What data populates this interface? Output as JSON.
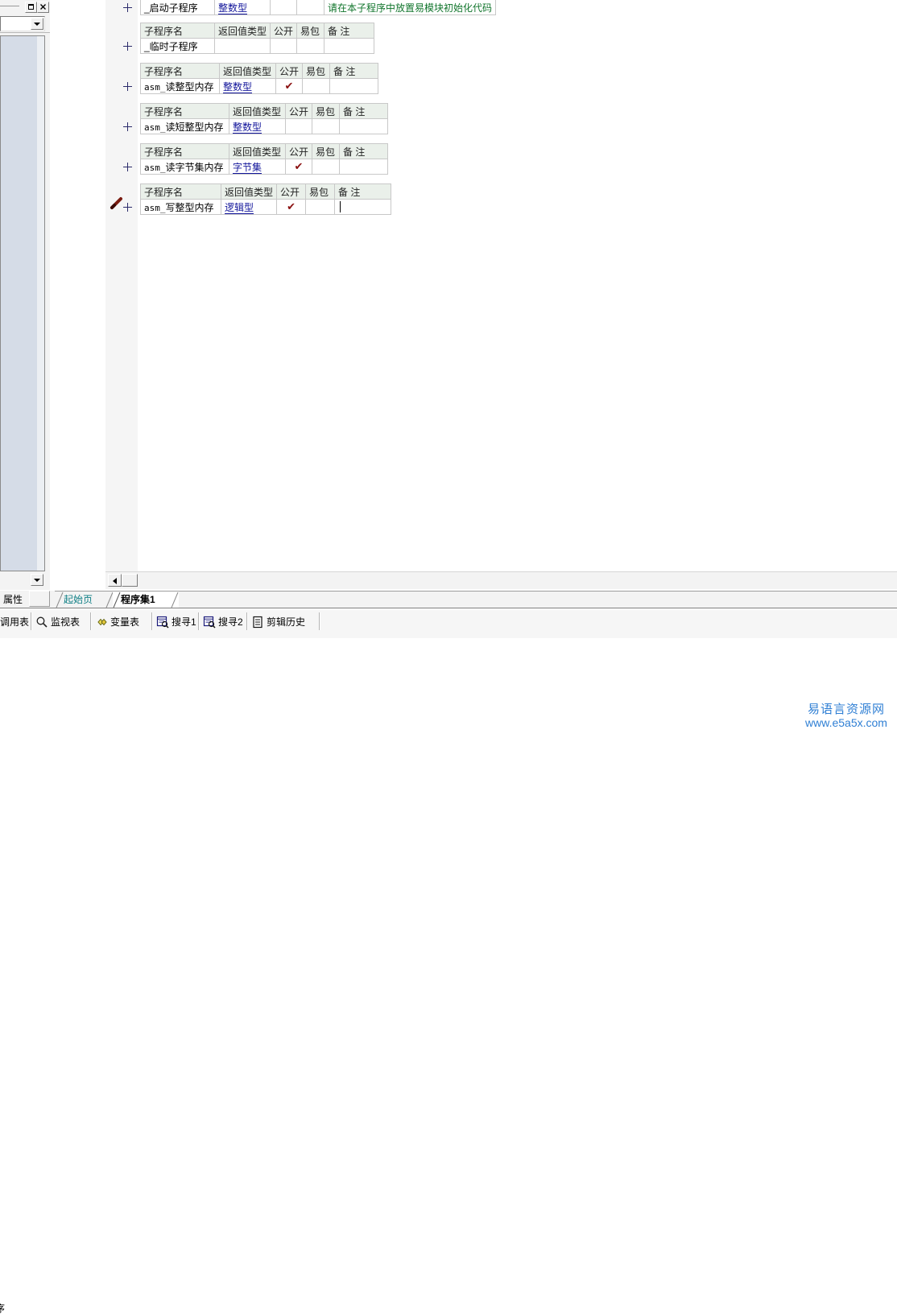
{
  "left_dock": {
    "restore_label": "□",
    "close_label": "✕",
    "combo_value": "",
    "scroll_down_label": "▼"
  },
  "editor": {
    "columns": [
      "子程序名",
      "返回值类型",
      "公开",
      "易包",
      "备 注"
    ],
    "expand_icon": "+",
    "edit_pen_icon": "pen-icon",
    "check_mark": "✔",
    "tables": [
      {
        "show_header": false,
        "name": "_启动子程序",
        "return_type": "整数型",
        "public": false,
        "easy_pack": false,
        "note": "请在本子程序中放置易模块初始化代码",
        "caret_in_note": false
      },
      {
        "show_header": true,
        "name": "_临时子程序",
        "return_type": "",
        "public": false,
        "easy_pack": false,
        "note": "",
        "caret_in_note": false
      },
      {
        "show_header": true,
        "name": "asm_读整型内存",
        "return_type": "整数型",
        "public": true,
        "easy_pack": false,
        "note": "",
        "caret_in_note": false
      },
      {
        "show_header": true,
        "name": "asm_读短整型内存",
        "return_type": "整数型",
        "public": false,
        "easy_pack": false,
        "note": "",
        "caret_in_note": false
      },
      {
        "show_header": true,
        "name": "asm_读字节集内存",
        "return_type": "字节集",
        "public": true,
        "easy_pack": false,
        "note": "",
        "caret_in_note": false
      },
      {
        "show_header": true,
        "name": "asm_写整型内存",
        "return_type": "逻辑型",
        "public": true,
        "easy_pack": false,
        "note": "",
        "caret_in_note": true
      }
    ]
  },
  "tabstrip": {
    "property_label": "属性",
    "documents": [
      {
        "label": "起始页",
        "active": false
      },
      {
        "label": "程序集1",
        "active": true
      }
    ]
  },
  "bottom_toolbar": {
    "items": [
      {
        "label": "调用表",
        "icon": ""
      },
      {
        "label": "监视表",
        "icon": "search-icon"
      },
      {
        "label": "变量表",
        "icon": "diamonds-icon"
      },
      {
        "label": "搜寻1",
        "icon": "find-window-icon"
      },
      {
        "label": "搜寻2",
        "icon": "find-window-icon"
      },
      {
        "label": "剪辑历史",
        "icon": "clipboard-icon"
      }
    ]
  },
  "output_pane": {
    "text": "序"
  },
  "watermark": {
    "cn": "易语言资源网",
    "url": "www.e5a5x.com",
    "color": "#2f7fd4"
  },
  "colors": {
    "header_bg": "#eaf0ea",
    "type_link": "#12159b",
    "note_green": "#11752c",
    "check_red": "#8a1010",
    "tab_teal": "#0f7f85",
    "sidebar_blue": "#d5dce7"
  }
}
